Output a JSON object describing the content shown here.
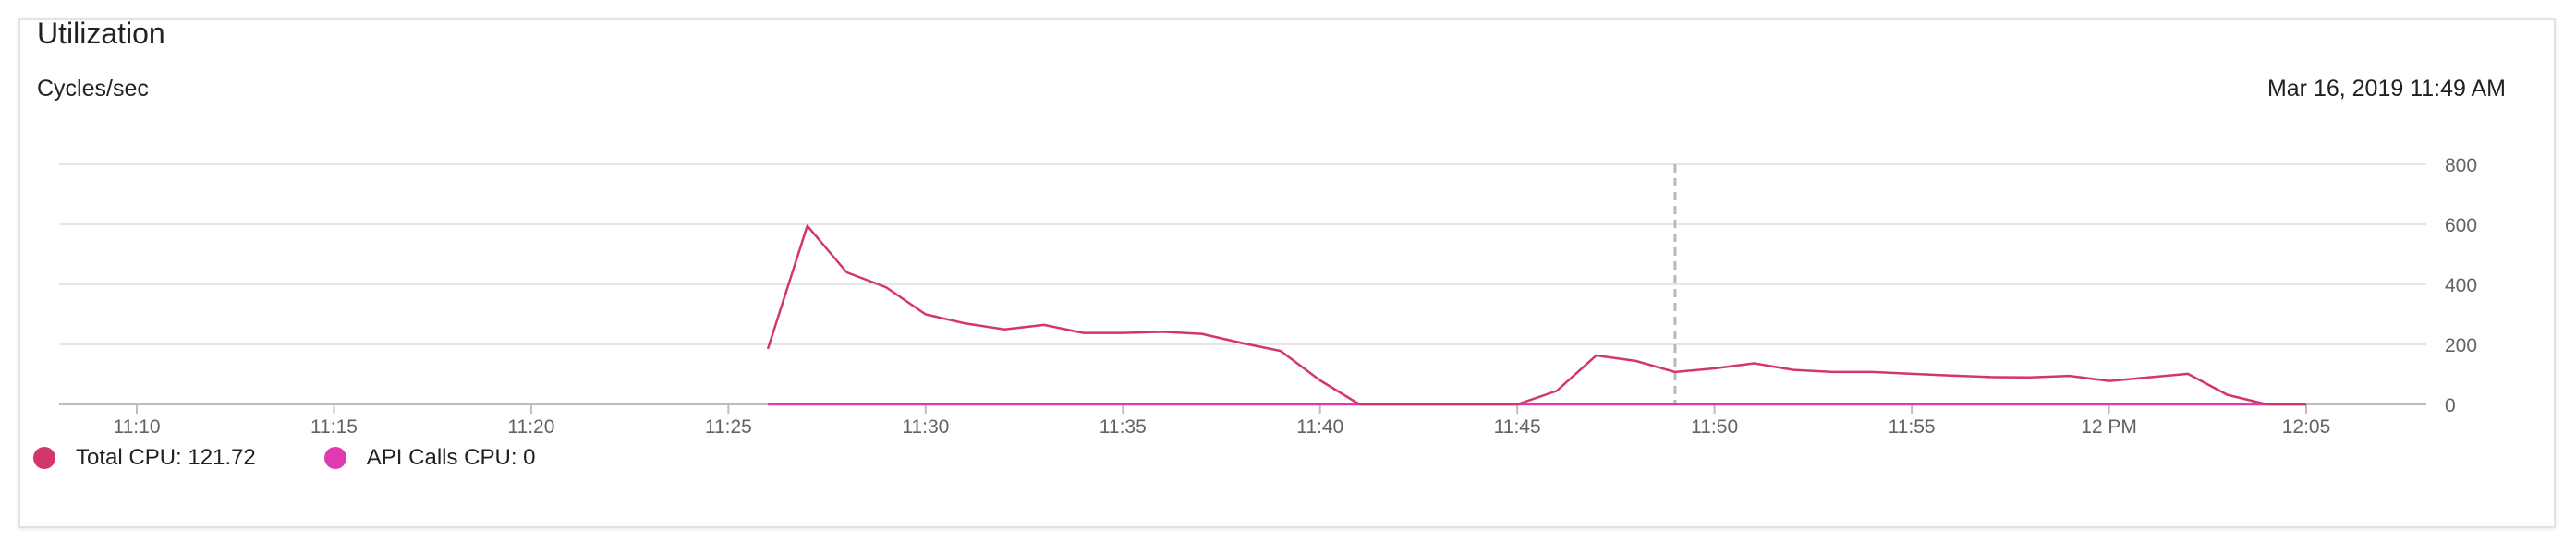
{
  "card": {
    "title": "Utilization",
    "unit_label": "Cycles/sec",
    "timestamp": "Mar 16, 2019 11:49 AM"
  },
  "legend": [
    {
      "label": "Total CPU: 121.72",
      "color": "#d3366b"
    },
    {
      "label": "API Calls CPU: 0",
      "color": "#e13ab0"
    }
  ],
  "chart_data": {
    "type": "line",
    "xlabel": "",
    "ylabel": "Cycles/sec",
    "ylim": [
      0,
      800
    ],
    "yticks": [
      800,
      600,
      400,
      200,
      0
    ],
    "x_ticks": [
      "11:10",
      "11:15",
      "11:20",
      "11:25",
      "11:30",
      "11:35",
      "11:40",
      "11:45",
      "11:50",
      "11:55",
      "12 PM",
      "12:05"
    ],
    "x_tick_minutes": [
      10,
      15,
      20,
      25,
      30,
      35,
      40,
      45,
      50,
      55,
      60,
      65
    ],
    "xlim_minutes": [
      8,
      76
    ],
    "y_axis_side": "right",
    "grid": true,
    "cursor_time": "11:49",
    "series": [
      {
        "name": "Total CPU",
        "color": "#d3366b",
        "x": [
          "11:26",
          "11:27",
          "11:28",
          "11:29",
          "11:30",
          "11:31",
          "11:32",
          "11:33",
          "11:34",
          "11:35",
          "11:36",
          "11:37",
          "11:38",
          "11:39",
          "11:40",
          "11:41",
          "11:42",
          "11:43",
          "11:44",
          "11:45",
          "11:46",
          "11:47",
          "11:48",
          "11:49",
          "11:50",
          "11:51",
          "11:52",
          "11:53",
          "11:54",
          "11:55",
          "11:56",
          "11:57",
          "11:58",
          "11:59",
          "12:00",
          "12:01",
          "12:02",
          "12:03",
          "12:04",
          "12:05"
        ],
        "y": [
          185,
          595,
          440,
          390,
          300,
          270,
          250,
          265,
          238,
          238,
          242,
          235,
          205,
          178,
          80,
          0,
          0,
          0,
          0,
          0,
          45,
          163,
          145,
          108,
          120,
          137,
          115,
          108,
          108,
          102,
          96,
          91,
          90,
          95,
          78,
          90,
          102,
          32,
          0,
          0
        ]
      },
      {
        "name": "API Calls CPU",
        "color": "#e13ab0",
        "x": [
          "11:26",
          "12:05"
        ],
        "y": [
          0,
          0
        ]
      }
    ]
  }
}
